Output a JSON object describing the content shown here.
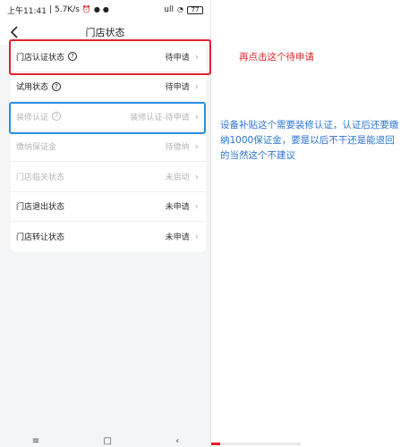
{
  "status_bar": {
    "time": "上午11:41",
    "speed": "5.7K/s",
    "signal": "ull",
    "battery": "77"
  },
  "header": {
    "back_icon": "arrow-left-icon",
    "title": "门店状态"
  },
  "rows": [
    {
      "label": "门店认证状态",
      "has_help": true,
      "value": "待申请",
      "disabled": false
    },
    {
      "label": "试用状态",
      "has_help": true,
      "value": "待申请",
      "disabled": false
    },
    {
      "label": "装修认证",
      "has_help": true,
      "value": "装修认证-待申请",
      "disabled": true
    },
    {
      "label": "缴纳保证金",
      "has_help": false,
      "value": "待缴纳",
      "disabled": true
    },
    {
      "label": "门店临关状态",
      "has_help": false,
      "value": "未启动",
      "disabled": true
    },
    {
      "label": "门店退出状态",
      "has_help": false,
      "value": "未申请",
      "disabled": false
    },
    {
      "label": "门店转让状态",
      "has_help": false,
      "value": "未申请",
      "disabled": false
    }
  ],
  "annotations": {
    "red_note": "再点击这个待申请",
    "blue_note": "设备补贴这个需要装修认证，认证后还要缴纳1000保证金，要是以后不干还是能退回的当然这个不建议",
    "red_color": "#e0242b",
    "blue_color": "#2b8ee6"
  },
  "bottom_nav": {
    "menu_icon": "menu-icon",
    "home_icon": "home-square-icon",
    "back_icon": "back-chevron-icon"
  }
}
